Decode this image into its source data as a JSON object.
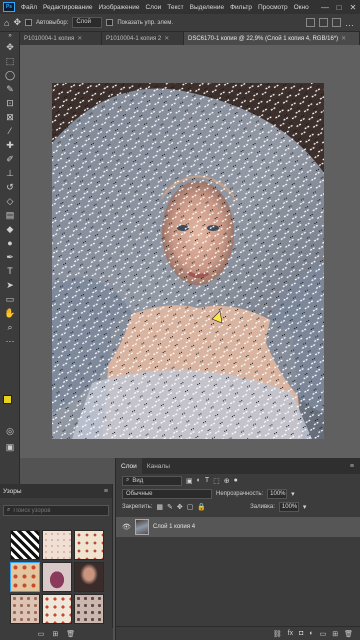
{
  "app": {
    "logo": "Ps"
  },
  "menu": [
    "Файл",
    "Редактирование",
    "Изображение",
    "Слои",
    "Текст",
    "Выделение",
    "Фильтр",
    "Просмотр",
    "Окно"
  ],
  "window_controls": [
    "—",
    "□",
    "✕"
  ],
  "options": {
    "autoselect_label": "Автовыбор:",
    "autoselect_value": "Слой",
    "show_controls_label": "Показать упр. элем."
  },
  "tabs": [
    {
      "label": "P1010004-1 копия",
      "active": false
    },
    {
      "label": "P1010004-1 копия 2",
      "active": false
    },
    {
      "label": "DSC6170-1 копия @ 22,9% (Слой 1 копия 4, RGB/16*)",
      "active": true
    }
  ],
  "layers_panel": {
    "tabs": [
      "Слои",
      "Каналы"
    ],
    "filter_label": "Вид",
    "blend_mode": "Обычные",
    "opacity_label": "Непрозрачность:",
    "opacity_value": "100%",
    "lock_label": "Закрепить:",
    "fill_label": "Заливка:",
    "fill_value": "100%",
    "layers": [
      {
        "name": "Слой 1 копия 4"
      }
    ]
  },
  "patterns_panel": {
    "title": "Узоры",
    "search_placeholder": "Поиск узоров"
  },
  "colors": {
    "foreground": "#e8d21d",
    "background": "#ffffff",
    "accent": "#31a8ff"
  }
}
